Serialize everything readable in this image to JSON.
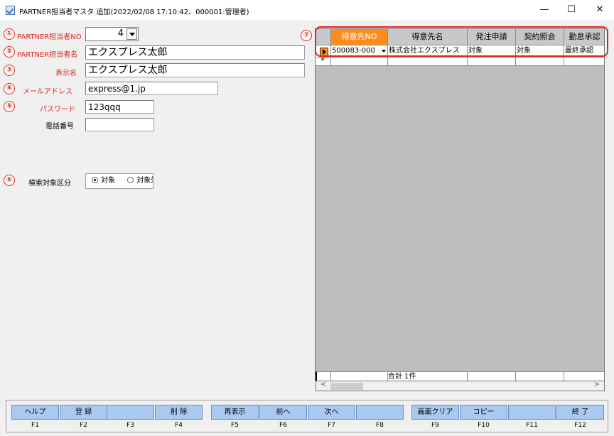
{
  "window": {
    "title": "PARTNER担当者マスタ 追加(2022/02/08 17:10:42、000001:管理者)",
    "minimize": "—",
    "maximize": "☐",
    "close": "✕"
  },
  "form": {
    "partner_no": {
      "badge": "①",
      "label": "PARTNER担当者NO",
      "value": "4"
    },
    "partner_name": {
      "badge": "②",
      "label": "PARTNER担当者名",
      "value": "エクスプレス太郎"
    },
    "display_name": {
      "badge": "③",
      "label": "表示名",
      "value": "エクスプレス太郎"
    },
    "email": {
      "badge": "④",
      "label": "メールアドレス",
      "value": "express@1.jp"
    },
    "password": {
      "badge": "⑤",
      "label": "パスワード",
      "value": "123qqq"
    },
    "phone": {
      "label": "電話番号",
      "value": ""
    },
    "search_target": {
      "badge": "⑥",
      "label": "検索対象区分",
      "options": [
        "対象",
        "対象外"
      ],
      "selected": "対象"
    }
  },
  "grid": {
    "badge": "⑦",
    "columns": [
      "得意先NO",
      "得意先名",
      "発注申請",
      "契約照会",
      "勤怠承認"
    ],
    "rows": [
      [
        "500083-000",
        "株式会社エクスプレス",
        "対象",
        "対象",
        "最終承認"
      ]
    ],
    "new_row_marker": "*",
    "total_label": "合計 1件",
    "colors": {
      "active_header": "#ff8c1a",
      "highlight": "#e0241c"
    }
  },
  "function_keys": [
    {
      "label": "ヘルプ",
      "key": "F1"
    },
    {
      "label": "登 録",
      "key": "F2"
    },
    {
      "label": "",
      "key": "F3"
    },
    {
      "label": "削 除",
      "key": "F4"
    },
    {
      "label": "再表示",
      "key": "F5"
    },
    {
      "label": "前へ",
      "key": "F6"
    },
    {
      "label": "次へ",
      "key": "F7"
    },
    {
      "label": "",
      "key": "F8"
    },
    {
      "label": "画面クリア",
      "key": "F9"
    },
    {
      "label": "コピー",
      "key": "F10"
    },
    {
      "label": "",
      "key": "F11"
    },
    {
      "label": "終 了",
      "key": "F12"
    }
  ]
}
